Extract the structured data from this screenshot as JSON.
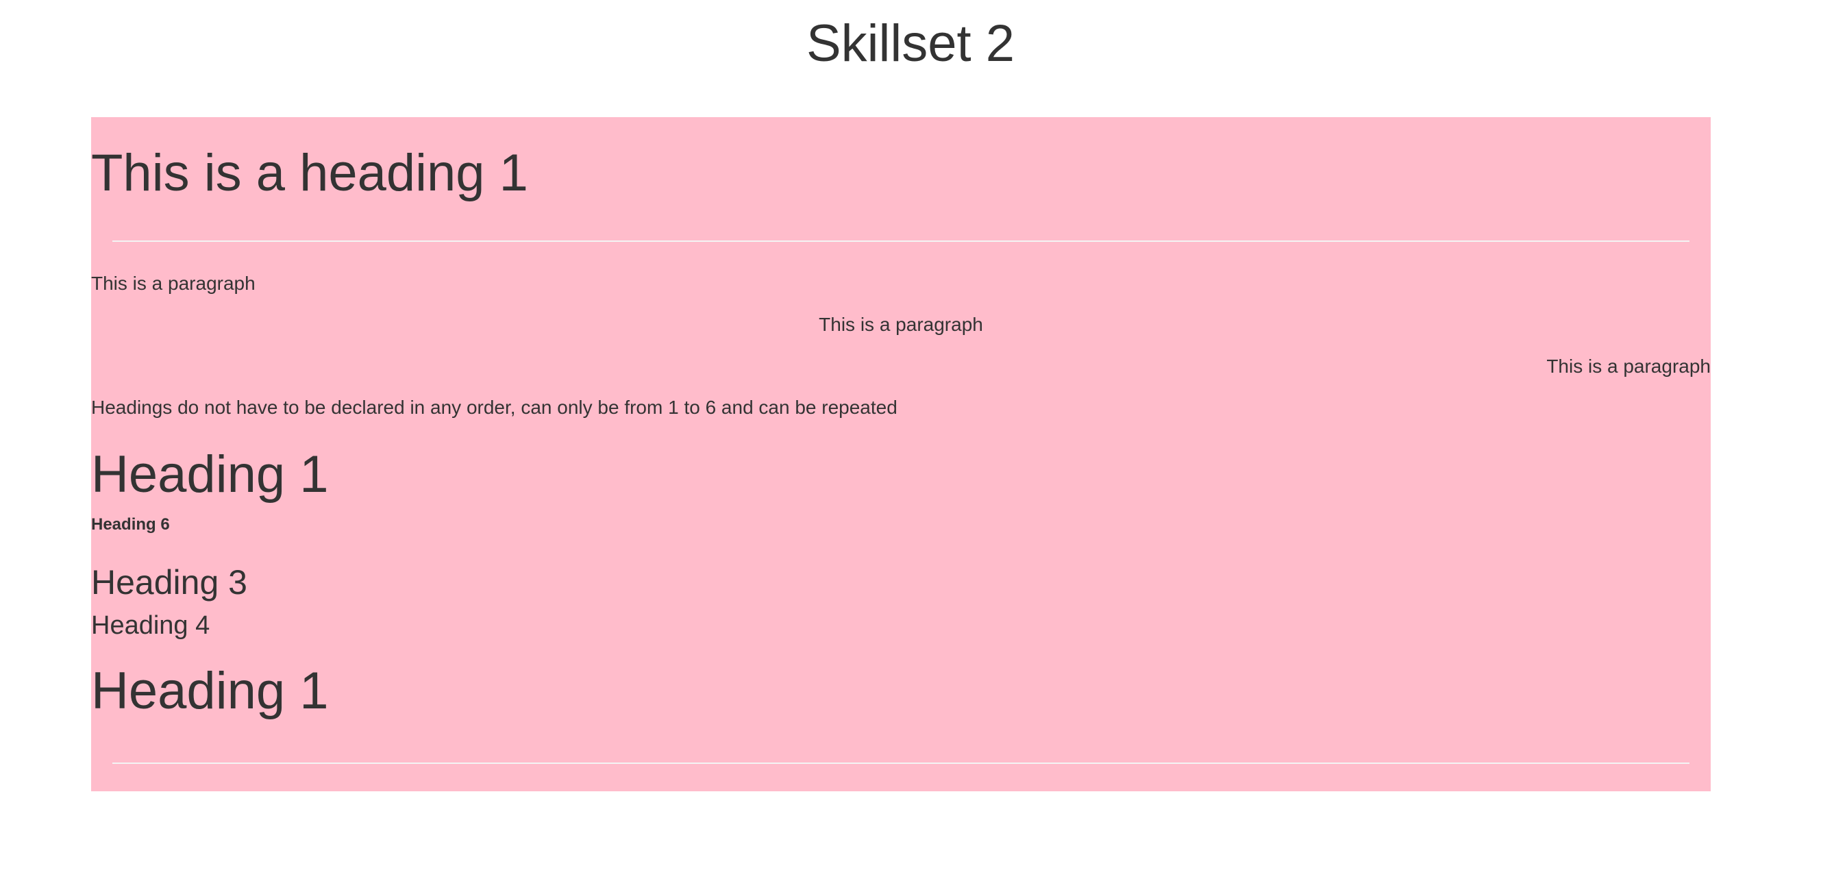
{
  "page": {
    "title": "Skillset 2"
  },
  "panel": {
    "background": "#ffbccb",
    "heading_main": "This is a heading 1",
    "paragraphs": {
      "left": "This is a paragraph",
      "center": "This is a paragraph",
      "right": "This is a paragraph"
    },
    "note": "Headings do not have to be declared in any order, can only be from 1 to 6 and can be repeated",
    "headings": [
      "Heading 1",
      "Heading 6",
      "Heading 3",
      "Heading 4",
      "Heading 1"
    ]
  }
}
